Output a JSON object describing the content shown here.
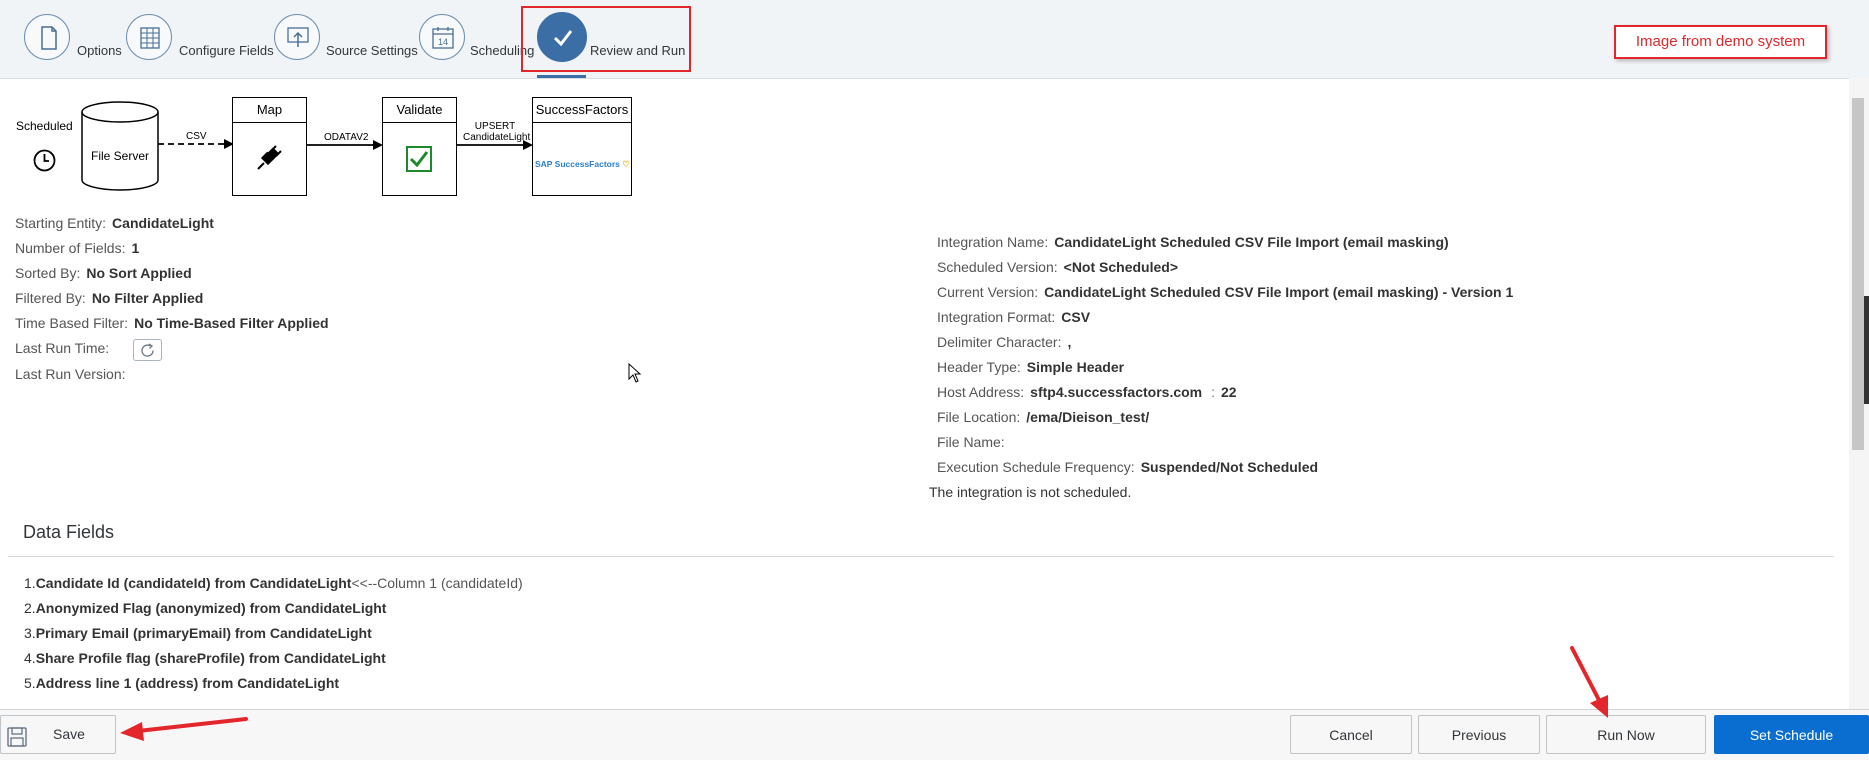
{
  "wizard": {
    "steps": [
      {
        "label": "Options",
        "icon": "document-icon"
      },
      {
        "label": "Configure Fields",
        "icon": "grid-icon"
      },
      {
        "label": "Source Settings",
        "icon": "upload-icon"
      },
      {
        "label": "Scheduling",
        "icon": "calendar-icon",
        "calendar_day": "14"
      },
      {
        "label": "Review and Run",
        "icon": "checkmark-icon",
        "active": true
      }
    ],
    "demo_label": "Image from demo system"
  },
  "flow": {
    "scheduled_label": "Scheduled",
    "file_server_label": "File Server",
    "csv_label": "CSV",
    "map_label": "Map",
    "odatav2_label": "ODATAV2",
    "validate_label": "Validate",
    "upsert_label_1": "UPSERT",
    "upsert_label_2": "CandidateLight",
    "successfactors_label": "SuccessFactors",
    "sf_logo_text": "SAP SuccessFactors"
  },
  "left_details": [
    {
      "key": "Starting Entity:",
      "value": "CandidateLight"
    },
    {
      "key": "Number of Fields:",
      "value": "1"
    },
    {
      "key": "Sorted By:",
      "value": "No Sort Applied"
    },
    {
      "key": "Filtered By:",
      "value": "No Filter Applied"
    },
    {
      "key": "Time Based Filter:",
      "value": "No Time-Based Filter Applied"
    },
    {
      "key": "Last Run Time:",
      "value": ""
    },
    {
      "key": "Last Run Version:",
      "value": ""
    }
  ],
  "right_details": [
    {
      "key": "Integration Name:",
      "value": "CandidateLight Scheduled CSV File Import (email masking)"
    },
    {
      "key": "Scheduled Version:",
      "value": "<Not Scheduled>"
    },
    {
      "key": "Current Version:",
      "value": "CandidateLight Scheduled CSV File Import (email masking) - Version 1"
    },
    {
      "key": "Integration Format:",
      "value": "CSV"
    },
    {
      "key": "Delimiter Character:",
      "value": ","
    },
    {
      "key": "Header Type:",
      "value": "Simple Header"
    },
    {
      "key": "Host Address:",
      "value": "sftp4.successfactors.com",
      "port_sep": ":",
      "port": "22"
    },
    {
      "key": "File Location:",
      "value": "/ema/Dieison_test/"
    },
    {
      "key": "File Name:",
      "value": ""
    },
    {
      "key": "Execution Schedule Frequency:",
      "value": "Suspended/Not Scheduled"
    }
  ],
  "not_scheduled_text": "The integration is not scheduled.",
  "data_fields": {
    "title": "Data Fields",
    "items": [
      {
        "num": "1.",
        "text": "Candidate Id (candidateId) from CandidateLight",
        "tail": "<<--Column 1 (candidateId)"
      },
      {
        "num": "2.",
        "text": "Anonymized Flag (anonymized) from CandidateLight",
        "tail": ""
      },
      {
        "num": "3.",
        "text": "Primary Email (primaryEmail) from CandidateLight",
        "tail": ""
      },
      {
        "num": "4.",
        "text": "Share Profile flag (shareProfile) from CandidateLight",
        "tail": ""
      },
      {
        "num": "5.",
        "text": "Address line 1 (address) from CandidateLight",
        "tail": ""
      }
    ]
  },
  "footer": {
    "save_label": "Save",
    "cancel_label": "Cancel",
    "previous_label": "Previous",
    "run_now_label": "Run Now",
    "set_schedule_label": "Set Schedule"
  },
  "colors": {
    "accent": "#0a6ed1",
    "step_active": "#3b6ea5",
    "annotation_red": "#e3262b"
  }
}
